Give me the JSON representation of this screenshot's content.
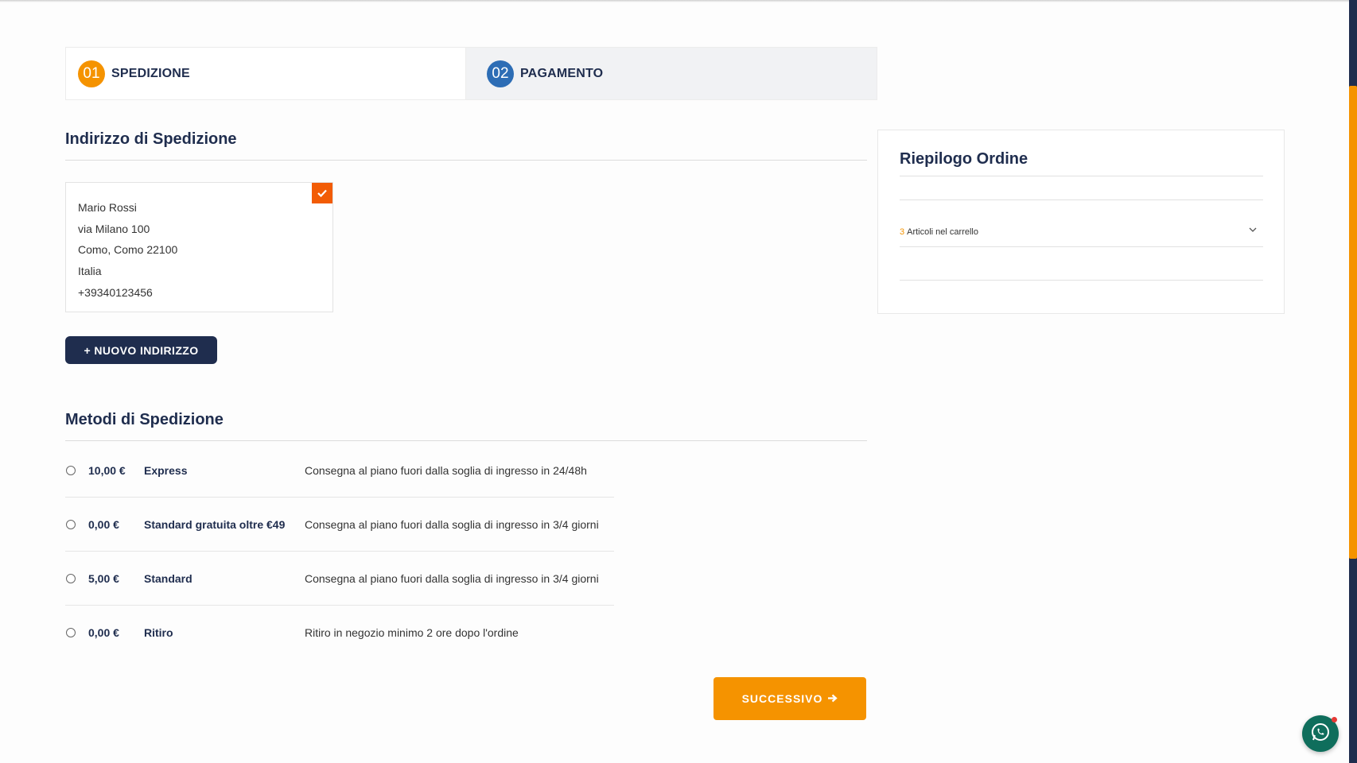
{
  "steps": [
    {
      "number": "01",
      "label": "SPEDIZIONE",
      "color": "#f59300"
    },
    {
      "number": "02",
      "label": "PAGAMENTO",
      "color": "#2d6db5"
    }
  ],
  "shipping_address": {
    "title": "Indirizzo di Spedizione",
    "lines": [
      "Mario Rossi",
      "via Milano 100",
      "Como, Como 22100",
      "Italia",
      "+39340123456"
    ],
    "selected_icon": "check-icon"
  },
  "new_address_label": "+ NUOVO INDIRIZZO",
  "shipping_methods": {
    "title": "Metodi di Spedizione",
    "options": [
      {
        "price": "10,00 €",
        "name": "Express",
        "description": "Consegna al piano fuori dalla soglia di ingresso in 24/48h"
      },
      {
        "price": "0,00 €",
        "name": "Standard gratuita oltre €49",
        "description": "Consegna al piano fuori dalla soglia di ingresso in 3/4 giorni"
      },
      {
        "price": "5,00 €",
        "name": "Standard",
        "description": "Consegna al piano fuori dalla soglia di ingresso in 3/4 giorni"
      },
      {
        "price": "0,00 €",
        "name": "Ritiro",
        "description": "Ritiro in negozio minimo 2 ore dopo l'ordine"
      }
    ]
  },
  "next_label": "SUCCESSIVO",
  "summary": {
    "title": "Riepilogo Ordine",
    "cart_count": "3",
    "cart_text": "Articoli nel carrello",
    "toggle_icon": "chevron-down-icon"
  },
  "colors": {
    "accent": "#f59300",
    "navy": "#1f2d4e",
    "blue": "#2d6db5",
    "check": "#f25c05"
  },
  "chat_icon": "whatsapp-icon"
}
